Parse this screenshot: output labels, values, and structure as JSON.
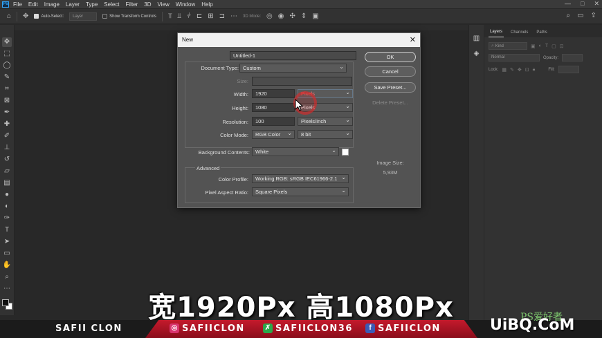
{
  "menubar": {
    "logo": "Ps",
    "items": [
      "File",
      "Edit",
      "Image",
      "Layer",
      "Type",
      "Select",
      "Filter",
      "3D",
      "View",
      "Window",
      "Help"
    ],
    "window_controls": [
      "—",
      "□",
      "✕"
    ]
  },
  "options": {
    "auto_select": "Auto-Select:",
    "auto_select_target": "Layer",
    "show_transform": "Show Transform Controls",
    "mode_3d": "3D Mode:"
  },
  "panel": {
    "tabs": [
      "Layers",
      "Channels",
      "Paths"
    ],
    "kind_placeholder": "Kind",
    "blend_mode": "Normal",
    "opacity_label": "Opacity:",
    "lock_label": "Lock:",
    "fill_label": "Fill:"
  },
  "dialog": {
    "title": "New",
    "name_label": "Name:",
    "name_value": "Untitled-1",
    "doctype_label": "Document Type:",
    "doctype_value": "Custom",
    "size_label": "Size:",
    "width_label": "Width:",
    "width_value": "1920",
    "width_unit": "Pixels",
    "height_label": "Height:",
    "height_value": "1080",
    "height_unit": "Pixels",
    "resolution_label": "Resolution:",
    "resolution_value": "100",
    "resolution_unit": "Pixels/Inch",
    "colormode_label": "Color Mode:",
    "colormode_value": "RGB Color",
    "bitdepth_value": "8 bit",
    "bg_label": "Background Contents:",
    "bg_value": "White",
    "advanced_label": "Advanced",
    "profile_label": "Color Profile:",
    "profile_value": "Working RGB:  sRGB IEC61966-2.1",
    "aspect_label": "Pixel Aspect Ratio:",
    "aspect_value": "Square Pixels",
    "ok": "OK",
    "cancel": "Cancel",
    "save_preset": "Save Preset...",
    "delete_preset": "Delete Preset...",
    "image_size_label": "Image Size:",
    "image_size_value": "5,93M"
  },
  "subtitle": "宽1920Px 高1080Px",
  "banner": {
    "left": "SAFII CLON",
    "instagram": "SAFIICLON",
    "other": "SAFIICLON36",
    "facebook": "SAFIICLON"
  },
  "watermark": {
    "main": "UiBQ.CoM",
    "sub": "PS爱好者"
  }
}
